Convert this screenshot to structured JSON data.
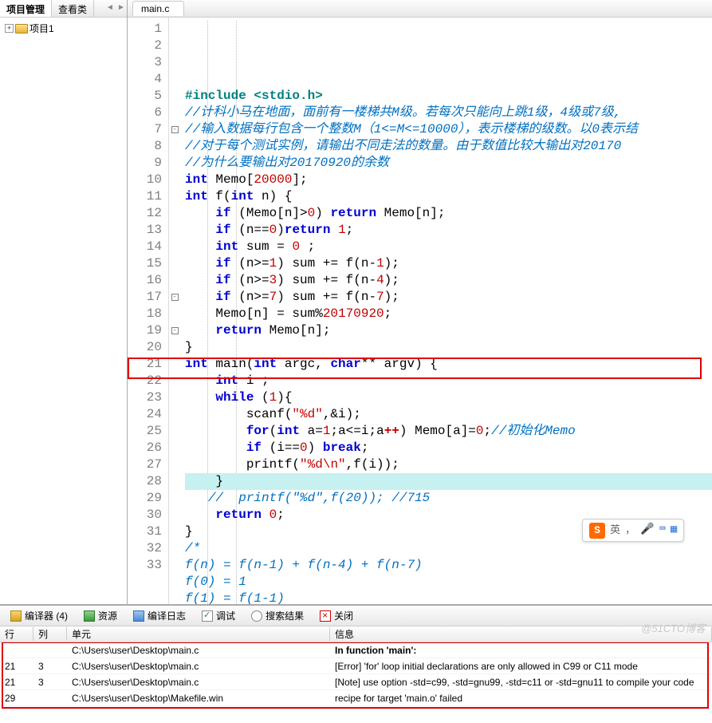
{
  "sidebar": {
    "tabs": {
      "project": "项目管理",
      "classes": "查看类"
    },
    "tree": {
      "root": "项目1"
    }
  },
  "file_tab": "main.c",
  "code_lines": [
    {
      "n": 1,
      "raw": "#include <stdio.h>",
      "cls": "pp"
    },
    {
      "n": 2,
      "raw": "//计科小马在地面，面前有一楼梯共M级。若每次只能向上跳1级，4级或7级,",
      "cls": "cm"
    },
    {
      "n": 3,
      "raw": "//输入数据每行包含一个整数M（1<=M<=10000），表示楼梯的级数。以0表示结",
      "cls": "cm"
    },
    {
      "n": 4,
      "raw": "//对于每个测试实例，请输出不同走法的数量。由于数值比较大输出对20170",
      "cls": "cm"
    },
    {
      "n": 5,
      "raw": "//为什么要输出对20170920的余数",
      "cls": "cm"
    },
    {
      "n": 6,
      "html": "<span class='ty'>int</span> Memo[<span class='nu'>20000</span>];"
    },
    {
      "n": 7,
      "fold": "-",
      "html": "<span class='ty'>int</span> f(<span class='ty'>int</span> n) {"
    },
    {
      "n": 8,
      "html": "    <span class='kw'>if</span> (Memo[n]&gt;<span class='nu'>0</span>) <span class='kw'>return</span> Memo[n];"
    },
    {
      "n": 9,
      "html": "    <span class='kw'>if</span> (n==<span class='nu'>0</span>)<span class='kw'>return</span> <span class='nu'>1</span>;"
    },
    {
      "n": 10,
      "html": "    <span class='ty'>int</span> sum = <span class='nu'>0</span> ;"
    },
    {
      "n": 11,
      "html": "    <span class='kw'>if</span> (n&gt;=<span class='nu'>1</span>) sum += f(n-<span class='nu'>1</span>);"
    },
    {
      "n": 12,
      "html": "    <span class='kw'>if</span> (n&gt;=<span class='nu'>3</span>) sum += f(n-<span class='nu'>4</span>);"
    },
    {
      "n": 13,
      "html": "    <span class='kw'>if</span> (n&gt;=<span class='nu'>7</span>) sum += f(n-<span class='nu'>7</span>);"
    },
    {
      "n": 14,
      "html": "    Memo[n] = sum%<span class='nu'>20170920</span>;"
    },
    {
      "n": 15,
      "html": "    <span class='kw'>return</span> Memo[n];"
    },
    {
      "n": 16,
      "html": "}"
    },
    {
      "n": 17,
      "fold": "-",
      "html": "<span class='ty'>int</span> main(<span class='ty'>int</span> argc, <span class='ty'>char</span>** argv) {"
    },
    {
      "n": 18,
      "html": "    <span class='ty'>int</span> i ;"
    },
    {
      "n": 19,
      "fold": "-",
      "html": "    <span class='kw'>while</span> (<span class='nu'>1</span>){"
    },
    {
      "n": 20,
      "html": "        scanf(<span class='st'>\"%d\"</span>,&amp;i);"
    },
    {
      "n": 21,
      "html": "        <span class='kw'>for</span>(<span class='ty'>int</span> a=<span class='nu'>1</span>;a&lt;=i;a<span class='op'>++</span>) Memo[a]=<span class='nu'>0</span>;<span class='cm'>//初始化Memo</span>"
    },
    {
      "n": 22,
      "html": "        <span class='kw'>if</span> (i==<span class='nu'>0</span>) <span class='kw'>break</span>;"
    },
    {
      "n": 23,
      "html": "        printf(<span class='st'>\"%d\\n\"</span>,f(i));"
    },
    {
      "n": 24,
      "hl": true,
      "html": "    }"
    },
    {
      "n": 25,
      "html": "   <span class='cm'>//  printf(\"%d\",f(20)); //715</span>"
    },
    {
      "n": 26,
      "html": "    <span class='kw'>return</span> <span class='nu'>0</span>;"
    },
    {
      "n": 27,
      "html": "}"
    },
    {
      "n": 28,
      "html": "<span class='cm'>/*</span>"
    },
    {
      "n": 29,
      "html": "<span class='cm'>f(n) = f(n-1) + f(n-4) + f(n-7)</span>"
    },
    {
      "n": 30,
      "html": "<span class='cm'>f(0) = 1</span>"
    },
    {
      "n": 31,
      "html": "<span class='cm'>f(1) = f(1-1)</span>"
    },
    {
      "n": 32,
      "html": "<span class='cm'>*/</span>"
    },
    {
      "n": 33,
      "html": ""
    }
  ],
  "ime": {
    "logo": "S",
    "text": "英",
    "punct": "，"
  },
  "bottom": {
    "tabs": {
      "compiler": "编译器 (4)",
      "resources": "资源",
      "log": "编译日志",
      "debug": "调试",
      "search": "搜索结果",
      "close": "关闭"
    },
    "headers": {
      "line": "行",
      "col": "列",
      "unit": "单元",
      "info": "信息"
    },
    "rows": [
      {
        "line": "",
        "col": "",
        "unit": "C:\\Users\\user\\Desktop\\main.c",
        "info": "In function 'main':",
        "head": true
      },
      {
        "line": "21",
        "col": "3",
        "unit": "C:\\Users\\user\\Desktop\\main.c",
        "info": "[Error] 'for' loop initial declarations are only allowed in C99 or C11 mode"
      },
      {
        "line": "21",
        "col": "3",
        "unit": "C:\\Users\\user\\Desktop\\main.c",
        "info": "[Note] use option -std=c99, -std=gnu99, -std=c11 or -std=gnu11 to compile your code"
      },
      {
        "line": "29",
        "col": "",
        "unit": "C:\\Users\\user\\Desktop\\Makefile.win",
        "info": "recipe for target 'main.o' failed"
      }
    ]
  },
  "watermark": "@51CTO博客"
}
